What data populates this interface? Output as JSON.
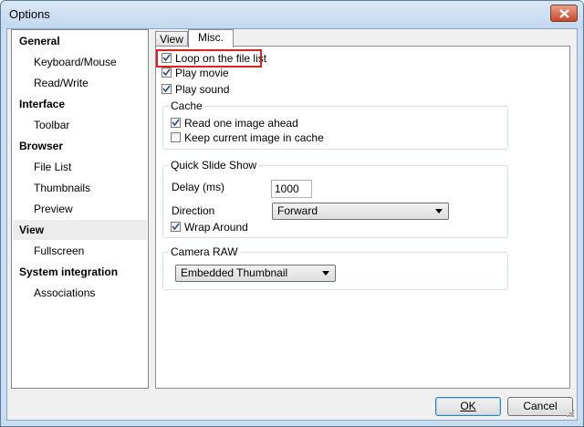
{
  "window": {
    "title": "Options"
  },
  "sidebar": {
    "items": [
      {
        "label": "General",
        "type": "head"
      },
      {
        "label": "Keyboard/Mouse",
        "type": "child"
      },
      {
        "label": "Read/Write",
        "type": "child"
      },
      {
        "label": "Interface",
        "type": "head"
      },
      {
        "label": "Toolbar",
        "type": "child"
      },
      {
        "label": "Browser",
        "type": "head"
      },
      {
        "label": "File List",
        "type": "child"
      },
      {
        "label": "Thumbnails",
        "type": "child"
      },
      {
        "label": "Preview",
        "type": "child"
      },
      {
        "label": "View",
        "type": "head",
        "selected": true
      },
      {
        "label": "Fullscreen",
        "type": "child"
      },
      {
        "label": "System integration",
        "type": "head"
      },
      {
        "label": "Associations",
        "type": "child"
      }
    ]
  },
  "tabs": [
    {
      "label": "View",
      "active": false
    },
    {
      "label": "Misc.",
      "active": true
    }
  ],
  "misc": {
    "loop_label": "Loop on the file list",
    "loop_checked": true,
    "movie_label": "Play movie",
    "movie_checked": true,
    "sound_label": "Play sound",
    "sound_checked": true,
    "cache": {
      "title": "Cache",
      "read_ahead_label": "Read one image ahead",
      "read_ahead_checked": true,
      "keep_label": "Keep current image in cache",
      "keep_checked": false
    },
    "slideshow": {
      "title": "Quick Slide Show",
      "delay_label": "Delay (ms)",
      "delay_value": "1000",
      "direction_label": "Direction",
      "direction_value": "Forward",
      "wrap_label": "Wrap Around",
      "wrap_checked": true
    },
    "raw": {
      "title": "Camera RAW",
      "mode_value": "Embedded Thumbnail"
    }
  },
  "buttons": {
    "ok": "OK",
    "cancel": "Cancel"
  },
  "colors": {
    "highlight": "#e02020",
    "title_bar": "#c9dcf0"
  }
}
